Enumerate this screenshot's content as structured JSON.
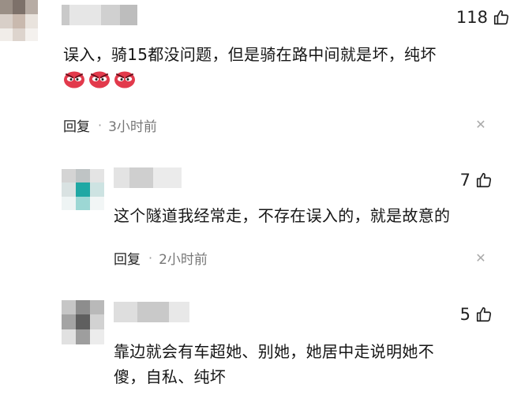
{
  "comments": [
    {
      "likes": "118",
      "text": "误入，骑15都没问题，但是骑在路中间就是坏，纯坏",
      "emojis": [
        "angry-face",
        "angry-face",
        "angry-face"
      ],
      "reply_label": "回复",
      "dot": "·",
      "time": "3小时前"
    },
    {
      "likes": "7",
      "text": "这个隧道我经常走，不存在误入的，就是故意的",
      "reply_label": "回复",
      "dot": "·",
      "time": "2小时前"
    },
    {
      "likes": "5",
      "text_line1": "靠边就会有车超她、别她，她居中走说明她不",
      "text_line2": "傻，自私、纯坏"
    }
  ]
}
